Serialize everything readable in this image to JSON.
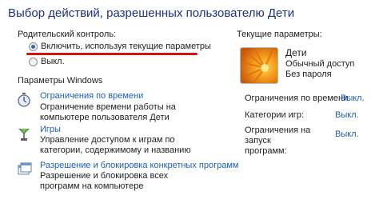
{
  "title": "Выбор действий, разрешенных пользователю Дети",
  "parental_control": {
    "heading": "Родительский контроль:",
    "options": [
      {
        "label": "Включить, используя текущие параметры",
        "selected": true
      },
      {
        "label": "Выкл.",
        "selected": false
      }
    ]
  },
  "windows_settings": {
    "heading": "Параметры Windows",
    "items": [
      {
        "link": "Ограничения по времени",
        "description": "Ограничение времени работы на компьютере пользователя Дети",
        "icon": "stopwatch-icon"
      },
      {
        "link": "Игры",
        "description": "Управление доступом к играм по категории, содержимому и названию",
        "icon": "games-icon"
      },
      {
        "link": "Разрешение и блокировка конкретных программ",
        "description": "Разрешение и блокировка всех программ на компьютере",
        "icon": "programs-icon"
      }
    ]
  },
  "current_settings": {
    "heading": "Текущие параметры:",
    "user_name": "Дети",
    "account_type": "Обычный доступ",
    "password": "Без пароля",
    "rows": [
      {
        "label": "Ограничения по времени:",
        "value": "Выкл."
      },
      {
        "label": "Категории игр:",
        "value": "Выкл."
      },
      {
        "label": "Ограничения на запуск программ:",
        "value": "Выкл."
      }
    ]
  },
  "colors": {
    "title": "#1e3287",
    "link": "#1c5fb4",
    "annotation": "#d21414"
  }
}
